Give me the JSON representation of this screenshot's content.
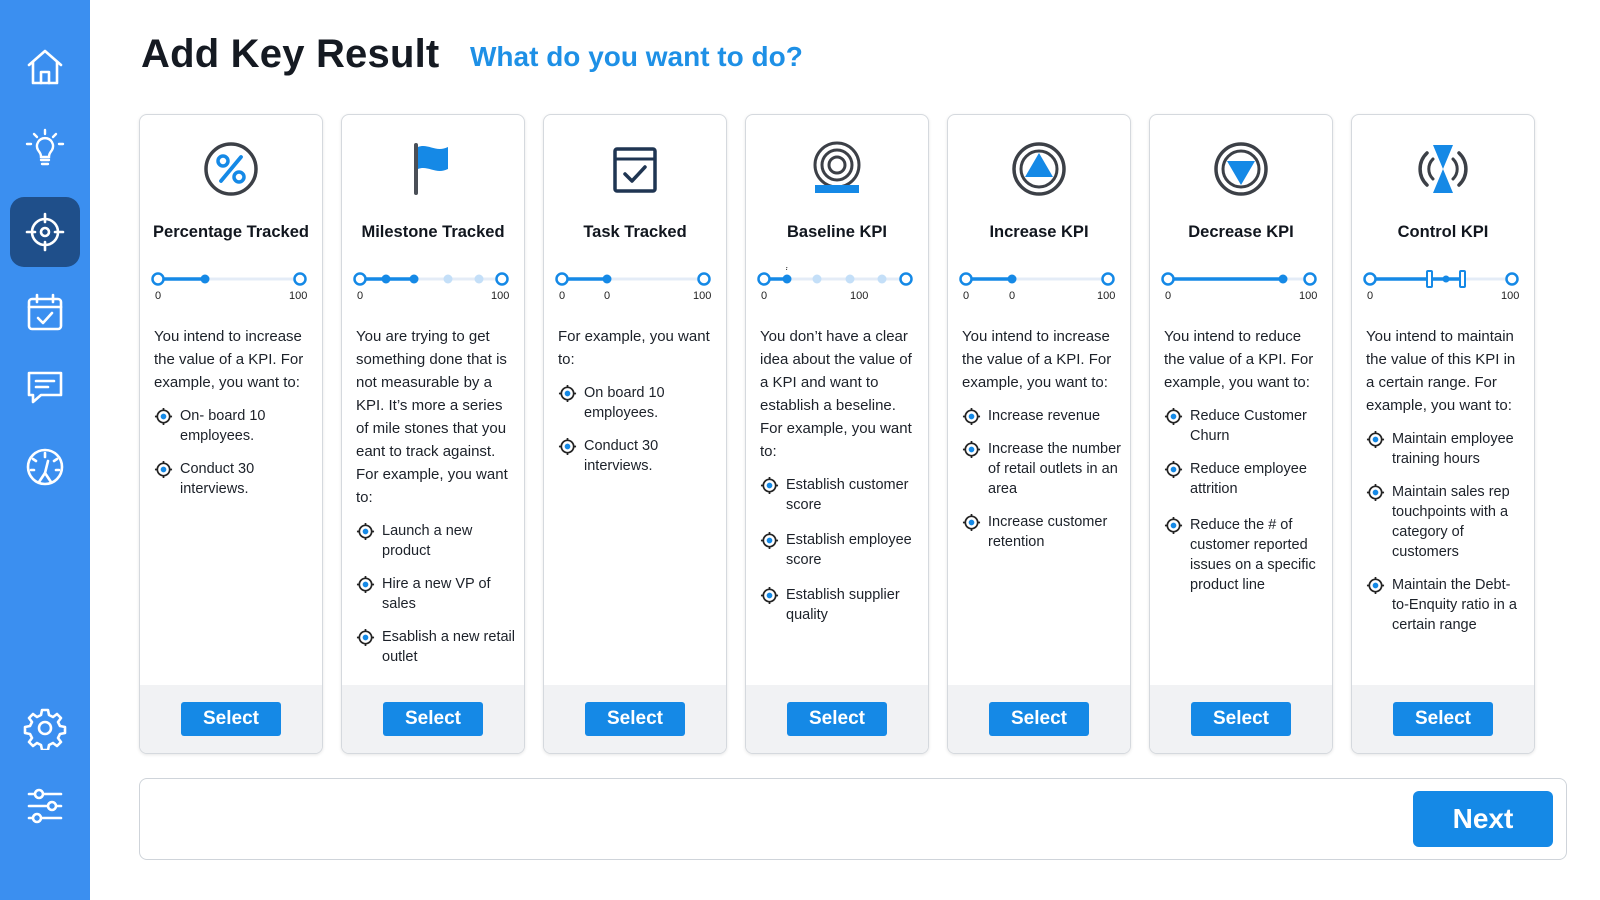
{
  "page": {
    "title": "Add Key Result",
    "subtitle": "What do you want to do?"
  },
  "sidebar": {
    "items": [
      {
        "icon": "home-icon",
        "active": false
      },
      {
        "icon": "lightbulb-icon",
        "active": false
      },
      {
        "icon": "target-icon",
        "active": true
      },
      {
        "icon": "calendar-check-icon",
        "active": false
      },
      {
        "icon": "chat-icon",
        "active": false
      },
      {
        "icon": "gauge-icon",
        "active": false
      },
      {
        "icon": "gear-icon",
        "active": false
      },
      {
        "icon": "sliders-icon",
        "active": false
      }
    ]
  },
  "colors": {
    "sidebar": "#3b8ff0",
    "sidebar_active": "#1f4f8a",
    "accent": "#1589e6",
    "subtitle": "#1e90e6",
    "card_footer": "#f1f2f4"
  },
  "cards": [
    {
      "title": "Percentage Tracked",
      "icon": "percent-icon",
      "slider": {
        "left_label": "0",
        "mid_label": "",
        "right_label": "100",
        "mid_hint": ""
      },
      "description": "You intend to increase the value of a KPI. For example, you want to:",
      "examples": [
        "On- board 10 employees.",
        "Conduct 30 interviews."
      ],
      "button": "Select"
    },
    {
      "title": "Milestone Tracked",
      "icon": "flag-icon",
      "slider": {
        "left_label": "0",
        "mid_label": "",
        "right_label": "100",
        "mid_hint": ""
      },
      "description": "You are trying to get something done that is not measurable by a KPI. It’s more a series of mile stones that you eant to track against. For example, you want to:",
      "examples": [
        "Launch a new product",
        "Hire a new VP of sales",
        "Esablish a new retail outlet"
      ],
      "button": "Select"
    },
    {
      "title": "Task Tracked",
      "icon": "task-check-icon",
      "slider": {
        "left_label": "0",
        "mid_label": "0",
        "right_label": "100",
        "mid_hint": ""
      },
      "description": "For example, you want to:",
      "examples": [
        "On board 10 employees.",
        "Conduct 30 interviews."
      ],
      "button": "Select"
    },
    {
      "title": "Baseline KPI",
      "icon": "baseline-target-icon",
      "slider": {
        "left_label": "0",
        "mid_label": "100",
        "right_label": "",
        "mid_hint": "?"
      },
      "description": "You don’t have a clear idea about the value of a KPI and want to establish a beseline. For example, you want to:",
      "examples": [
        "Establish customer score",
        "Establish employee score",
        "Establish supplier quality"
      ],
      "button": "Select"
    },
    {
      "title": "Increase KPI",
      "icon": "increase-arrow-icon",
      "slider": {
        "left_label": "0",
        "mid_label": "0",
        "right_label": "100",
        "mid_hint": ""
      },
      "description": "You intend to increase the value of a KPI. For example, you want to:",
      "examples": [
        "Increase revenue",
        "Increase the number of retail outlets in an area",
        "Increase customer retention"
      ],
      "button": "Select"
    },
    {
      "title": "Decrease KPI",
      "icon": "decrease-arrow-icon",
      "slider": {
        "left_label": "0",
        "mid_label": "",
        "right_label": "100",
        "mid_hint": ""
      },
      "description": "You intend to reduce the value of a KPI. For example, you want to:",
      "examples": [
        "Reduce Customer Churn",
        "Reduce employee attrition",
        "Reduce the # of customer reported issues on a specific product line"
      ],
      "button": "Select"
    },
    {
      "title": "Control KPI",
      "icon": "control-hourglass-icon",
      "slider": {
        "left_label": "0",
        "mid_label": "",
        "right_label": "100",
        "mid_hint": ""
      },
      "description": "You intend to maintain the value of this KPI in a certain range. For example, you want to:",
      "examples": [
        "Maintain employee training hours",
        "Maintain sales rep touchpoints with a category of customers",
        "Maintain the Debt-to-Enquity ratio in a certain range"
      ],
      "button": "Select"
    }
  ],
  "footer": {
    "next_button": "Next"
  }
}
